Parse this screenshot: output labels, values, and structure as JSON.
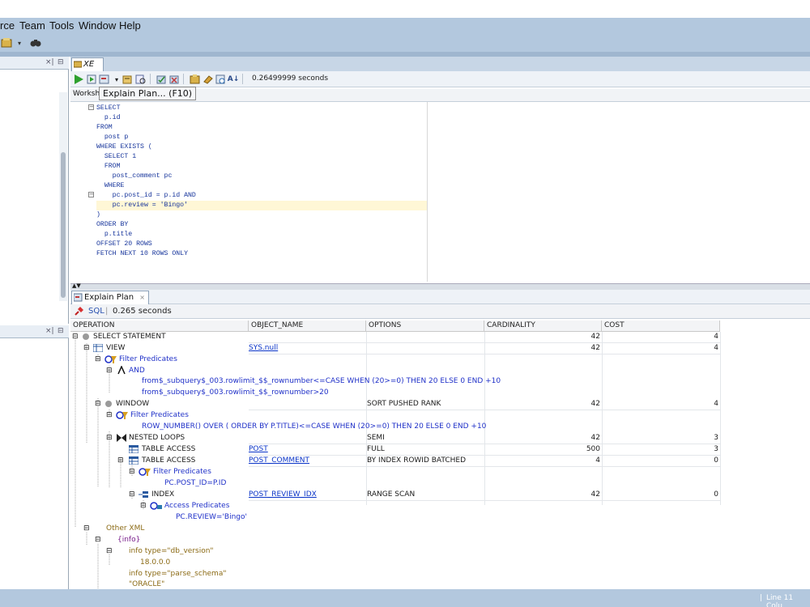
{
  "menubar": {
    "items": [
      "rce",
      "Team",
      "Tools",
      "Window",
      "Help"
    ]
  },
  "editor": {
    "tab_label": "XE",
    "elapsed": "0.26499999 seconds",
    "tooltip": "Explain Plan... (F10)",
    "worksheet_tab": "Worksh",
    "code_lines": [
      "SELECT",
      "  p.id",
      "FROM",
      "  post p",
      "WHERE EXISTS (",
      "  SELECT 1",
      "  FROM",
      "    post_comment pc",
      "  WHERE",
      "    pc.post_id = p.id AND",
      "    pc.review = 'Bingo'",
      ")",
      "ORDER BY",
      "  p.title",
      "OFFSET 20 ROWS",
      "FETCH NEXT 10 ROWS ONLY"
    ]
  },
  "explain": {
    "tab_label": "Explain Plan",
    "tool_label": "SQL",
    "elapsed": "0.265 seconds",
    "columns": [
      "OPERATION",
      "OBJECT_NAME",
      "OPTIONS",
      "CARDINALITY",
      "COST"
    ],
    "rows": [
      {
        "op": "SELECT STATEMENT",
        "obj": "",
        "opt": "",
        "card": "42",
        "cost": "4"
      },
      {
        "op": "VIEW",
        "obj": "SYS.null",
        "opt": "",
        "card": "42",
        "cost": "4"
      },
      {
        "op": "Filter Predicates",
        "obj": "",
        "opt": "",
        "card": "",
        "cost": ""
      },
      {
        "op": "AND",
        "obj": "",
        "opt": "",
        "card": "",
        "cost": ""
      },
      {
        "op": "from$_subquery$_003.rowlimit_$$_rownumber<=CASE  WHEN (20>=0) THEN 20 ELSE 0 END +10",
        "obj": "",
        "opt": "",
        "card": "",
        "cost": ""
      },
      {
        "op": "from$_subquery$_003.rowlimit_$$_rownumber>20",
        "obj": "",
        "opt": "",
        "card": "",
        "cost": ""
      },
      {
        "op": "WINDOW",
        "obj": "",
        "opt": "SORT PUSHED RANK",
        "card": "42",
        "cost": "4"
      },
      {
        "op": "Filter Predicates",
        "obj": "",
        "opt": "",
        "card": "",
        "cost": ""
      },
      {
        "op": "ROW_NUMBER() OVER ( ORDER BY P.TITLE)<=CASE  WHEN (20>=0) THEN 20 ELSE 0 END +10",
        "obj": "",
        "opt": "",
        "card": "",
        "cost": ""
      },
      {
        "op": "NESTED LOOPS",
        "obj": "",
        "opt": "SEMI",
        "card": "42",
        "cost": "3"
      },
      {
        "op": "TABLE ACCESS",
        "obj": "POST",
        "opt": "FULL",
        "card": "500",
        "cost": "3"
      },
      {
        "op": "TABLE ACCESS",
        "obj": "POST_COMMENT",
        "opt": "BY INDEX ROWID BATCHED",
        "card": "4",
        "cost": "0"
      },
      {
        "op": "Filter Predicates",
        "obj": "",
        "opt": "",
        "card": "",
        "cost": ""
      },
      {
        "op": "PC.POST_ID=P.ID",
        "obj": "",
        "opt": "",
        "card": "",
        "cost": ""
      },
      {
        "op": "INDEX",
        "obj": "POST_REVIEW_IDX",
        "opt": "RANGE SCAN",
        "card": "42",
        "cost": "0"
      },
      {
        "op": "Access Predicates",
        "obj": "",
        "opt": "",
        "card": "",
        "cost": ""
      },
      {
        "op": "PC.REVIEW='Bingo'",
        "obj": "",
        "opt": "",
        "card": "",
        "cost": ""
      }
    ],
    "xml": [
      "Other XML",
      "{info}",
      "info type=\"db_version\"",
      "18.0.0.0",
      "info type=\"parse_schema\"",
      "\"ORACLE\""
    ]
  },
  "statusbar": {
    "text": "Line 11 Colu"
  }
}
